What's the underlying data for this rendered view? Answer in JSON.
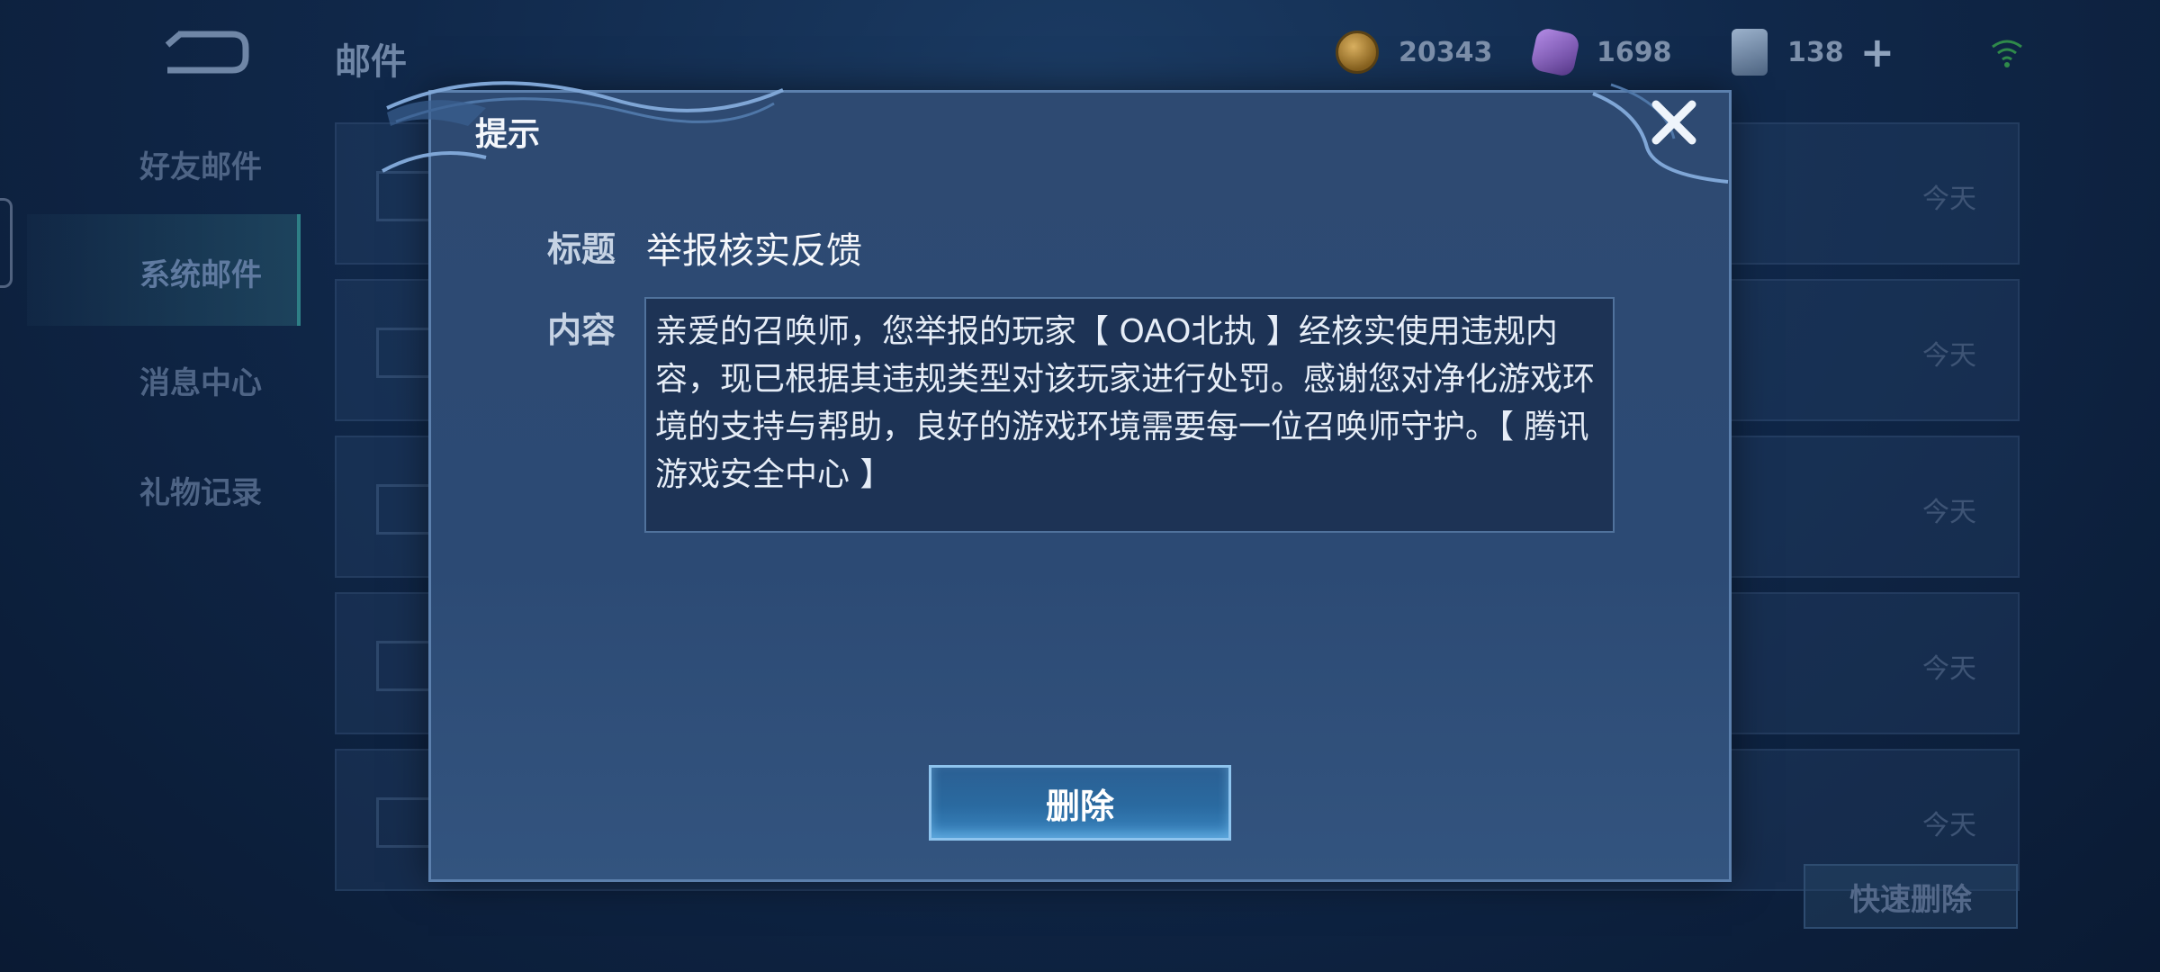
{
  "header": {
    "title": "邮件",
    "gold": "20343",
    "gems": "1698",
    "cards": "138"
  },
  "sidebar": {
    "items": [
      {
        "label": "好友邮件"
      },
      {
        "label": "系统邮件"
      },
      {
        "label": "消息中心"
      },
      {
        "label": "礼物记录"
      }
    ]
  },
  "mail_list": {
    "rows": [
      {
        "date": "今天"
      },
      {
        "date": "今天"
      },
      {
        "date": "今天"
      },
      {
        "date": "今天"
      },
      {
        "date": "今天"
      }
    ]
  },
  "quick_delete_label": "快速删除",
  "dialog": {
    "title": "提示",
    "subject_label": "标题",
    "subject": "举报核实反馈",
    "content_label": "内容",
    "content": "亲爱的召唤师，您举报的玩家【 OAO北执 】经核实使用违规内容，现已根据其违规类型对该玩家进行处罚。感谢您对净化游戏环境的支持与帮助，良好的游戏环境需要每一位召唤师守护。【 腾讯游戏安全中心 】",
    "delete_label": "删除"
  },
  "colors": {
    "accent": "#8ec4ee",
    "dialog_bg": "#2e4a72",
    "page_bg": "#10284a"
  }
}
